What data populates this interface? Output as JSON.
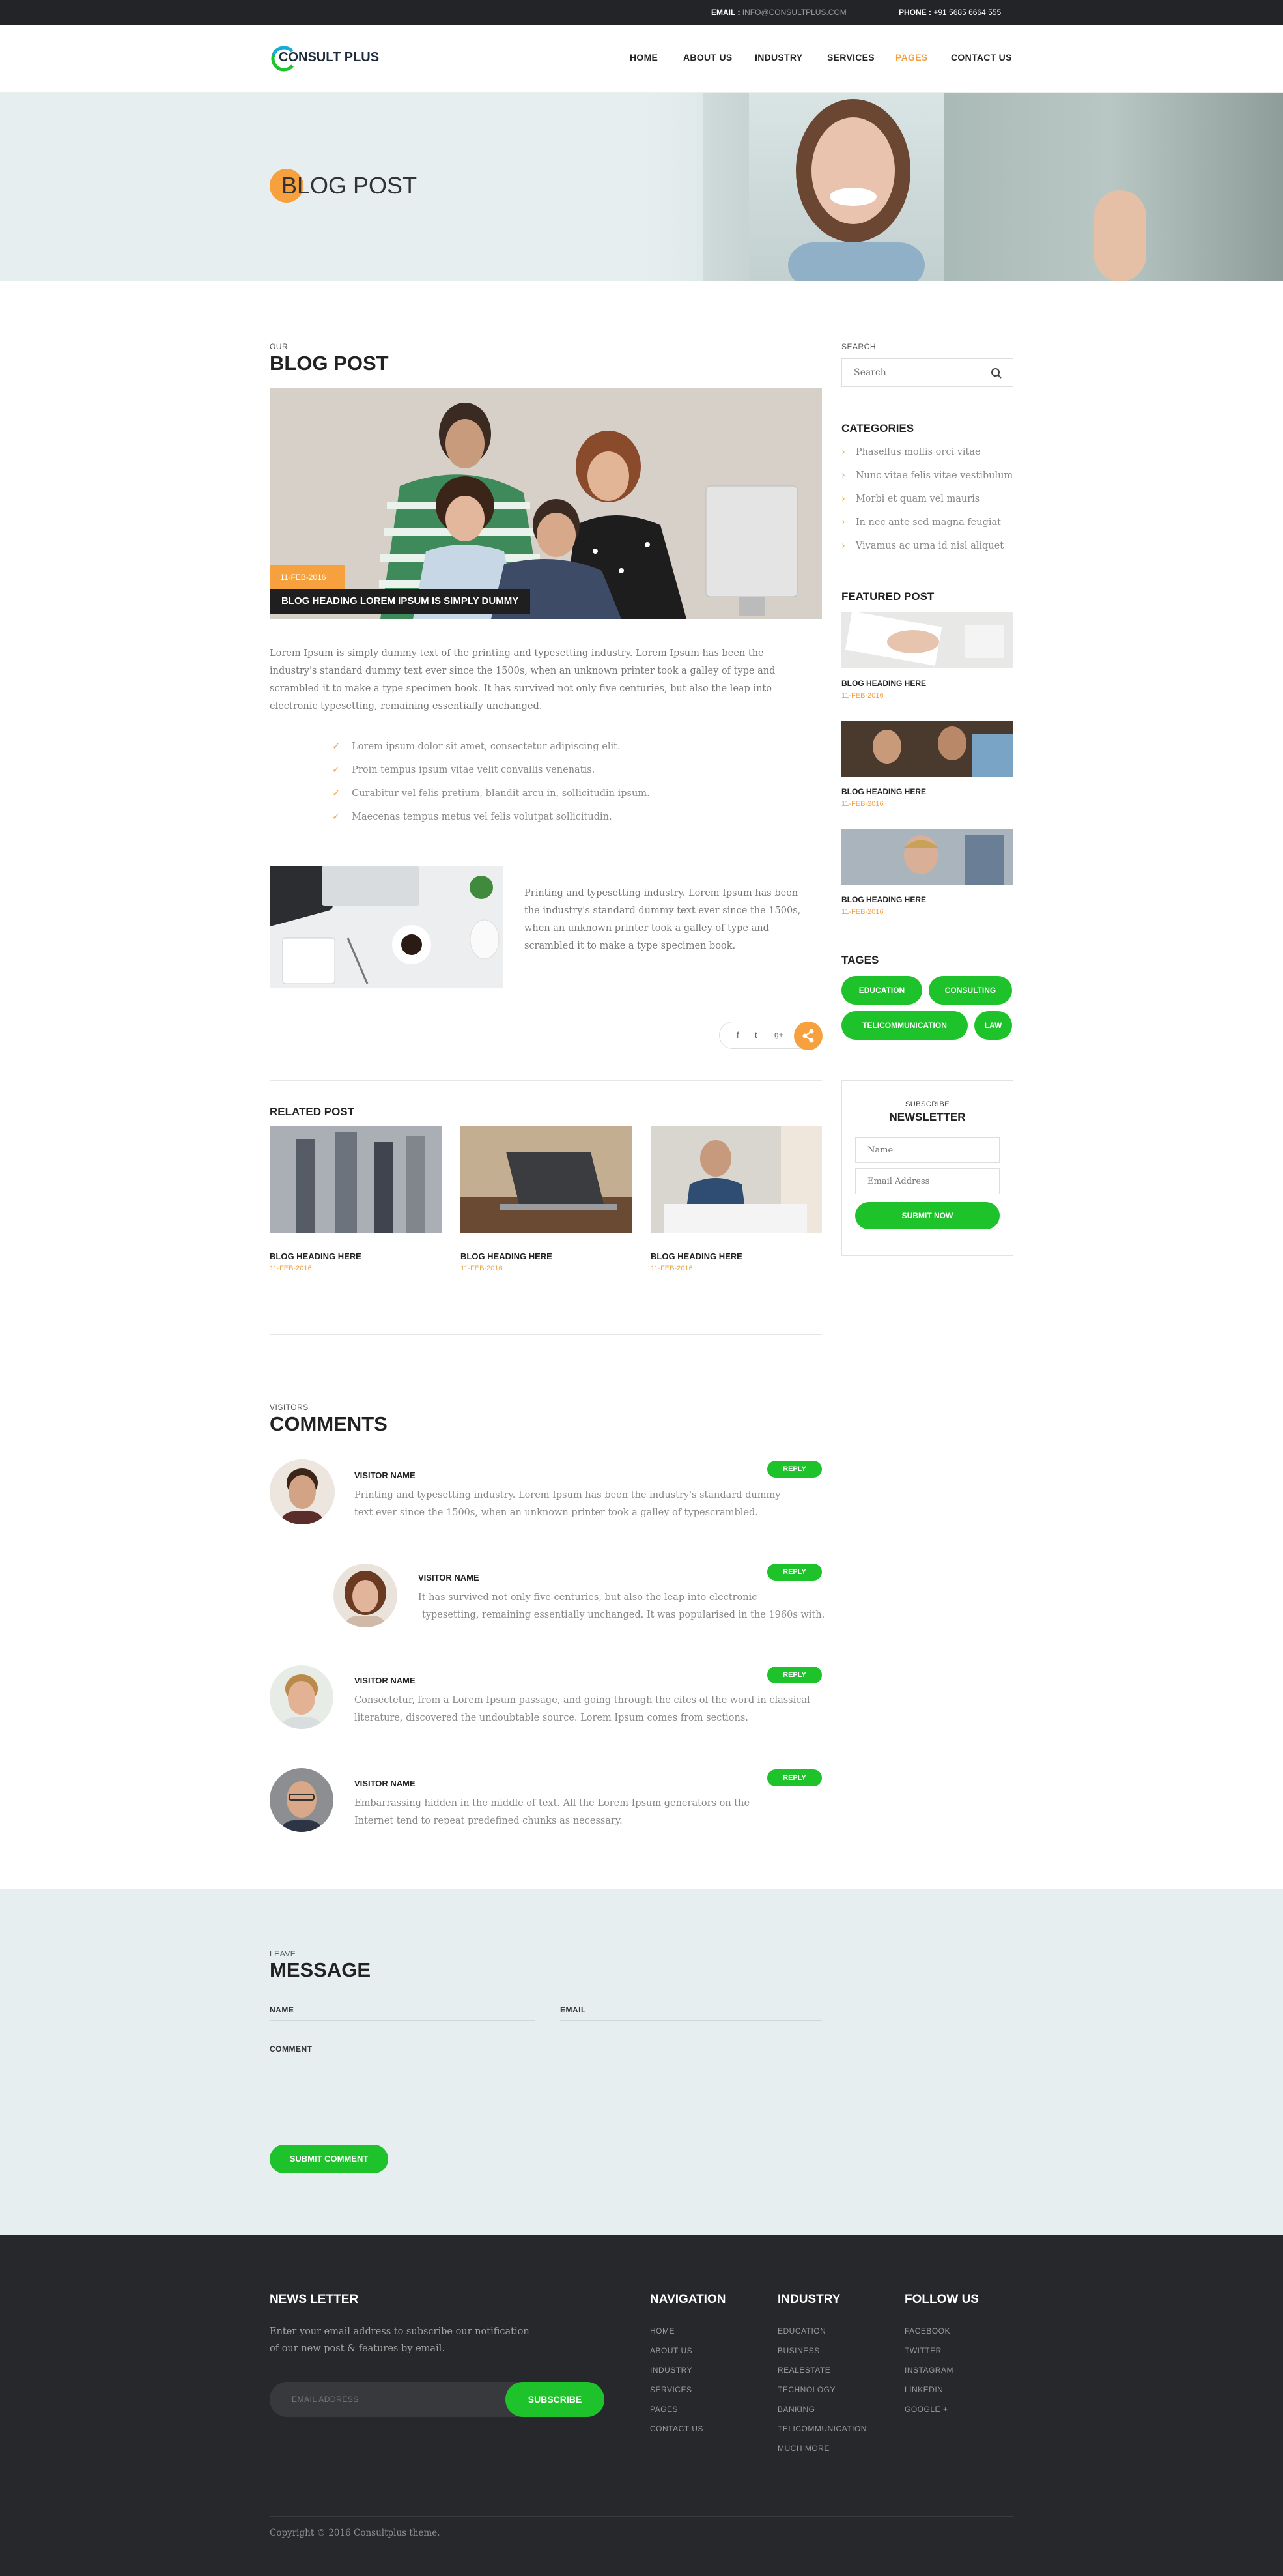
{
  "topbar": {
    "email_label": "EMAIL :",
    "email_value": "INFO@CONSULTPLUS.COM",
    "phone_label": "PHONE :",
    "phone_value": "+91 5685 6664 555"
  },
  "brand": {
    "logo_letter": "C",
    "logo_rest": "ONSULT PLUS"
  },
  "nav": {
    "items": [
      "HOME",
      "ABOUT US",
      "INDUSTRY",
      "SERVICES",
      "PAGES",
      "CONTACT US"
    ],
    "active": "PAGES"
  },
  "hero": {
    "title_first": "B",
    "title_rest": "LOG POST"
  },
  "main": {
    "eyebrow": "OUR",
    "title": "BLOG POST",
    "image_date": "11-FEB-2016",
    "image_heading": "BLOG HEADING LOREM IPSUM IS SIMPLY DUMMY",
    "paragraph": "Lorem Ipsum is simply dummy text of the printing and typesetting industry. Lorem Ipsum has been the industry's standard dummy text ever since the 1500s, when an unknown printer took a galley of type and scrambled it to make a type specimen book. It has survived not only five centuries, but also the leap into electronic typesetting, remaining essentially unchanged.",
    "checklist": [
      "Lorem ipsum dolor sit amet, consectetur adipiscing elit.",
      "Proin tempus ipsum vitae velit convallis venenatis.",
      "Curabitur vel felis pretium, blandit arcu in, sollicitudin ipsum.",
      "Maecenas tempus metus vel felis volutpat sollicitudin."
    ],
    "side_text": "Printing and typesetting industry. Lorem Ipsum has been the industry's standard dummy text ever since the 1500s, when an unknown printer took a galley of type and scrambled it to make a type specimen book.",
    "share": {
      "facebook": "f",
      "twitter": "t",
      "google": "g+"
    }
  },
  "related": {
    "title": "RELATED POST",
    "posts": [
      {
        "heading": "BLOG HEADING HERE",
        "date": "11-FEB-2016"
      },
      {
        "heading": "BLOG HEADING HERE",
        "date": "11-FEB-2016"
      },
      {
        "heading": "BLOG HEADING HERE",
        "date": "11-FEB-2016"
      }
    ]
  },
  "sidebar": {
    "search_label": "SEARCH",
    "search_placeholder": "Search",
    "categories_title": "CATEGORIES",
    "categories": [
      "Phasellus mollis orci vitae",
      "Nunc vitae felis vitae vestibulum",
      "Morbi et quam vel mauris",
      "In nec ante sed magna feugiat",
      "Vivamus ac urna id nisl aliquet"
    ],
    "featured_title": "FEATURED POST",
    "featured": [
      {
        "heading": "BLOG HEADING HERE",
        "date": "11-FEB-2016"
      },
      {
        "heading": "BLOG HEADING HERE",
        "date": "11-FEB-2016"
      },
      {
        "heading": "BLOG HEADING HERE",
        "date": "11-FEB-2016"
      }
    ],
    "tags_title": "TAGES",
    "tags": [
      "EDUCATION",
      "CONSULTING",
      "TELICOMMUNICATION",
      "LAW"
    ],
    "newsletter": {
      "eyebrow": "SUBSCRIBE",
      "title": "NEWSLETTER",
      "name_placeholder": "Name",
      "email_placeholder": "Email Address",
      "button": "SUBMIT NOW"
    }
  },
  "comments": {
    "eyebrow": "VISITORS",
    "title": "COMMENTS",
    "reply_label": "REPLY",
    "items": [
      {
        "name": "VISITOR NAME",
        "text1": "Printing and typesetting industry. Lorem Ipsum has been the industry's standard dummy",
        "text2": "text ever since the 1500s, when an unknown printer took a galley of typescrambled."
      },
      {
        "name": "VISITOR NAME",
        "text1": "It has survived not only five centuries, but also the leap into electronic",
        "text2": "typesetting, remaining essentially unchanged. It was popularised in the 1960s with."
      },
      {
        "name": "VISITOR NAME",
        "text1": "Consectetur, from a Lorem Ipsum passage, and going through the cites of the word in classical",
        "text2": "literature, discovered the undoubtable source. Lorem Ipsum comes from sections."
      },
      {
        "name": "VISITOR NAME",
        "text1": "Embarrassing hidden in the middle of text. All the Lorem Ipsum generators on the",
        "text2": "Internet tend to repeat predefined chunks as necessary."
      }
    ]
  },
  "message": {
    "eyebrow": "LEAVE",
    "title": "MESSAGE",
    "name_label": "NAME",
    "email_label": "EMAIL",
    "comment_label": "COMMENT",
    "button": "SUBMIT COMMENT"
  },
  "footer": {
    "newsletter_title": "NEWS LETTER",
    "newsletter_text1": "Enter your email address to subscribe our notification",
    "newsletter_text2": "of our new post & features by email.",
    "email_placeholder": "EMAIL ADDRESS",
    "subscribe": "SUBSCRIBE",
    "navigation_title": "NAVIGATION",
    "navigation": [
      "HOME",
      "ABOUT US",
      "INDUSTRY",
      "SERVICES",
      "PAGES",
      "CONTACT US"
    ],
    "industry_title": "INDUSTRY",
    "industry": [
      "EDUCATION",
      "BUSINESS",
      "REALESTATE",
      "TECHNOLOGY",
      "BANKING",
      "TELICOMMUNICATION",
      "MUCH MORE"
    ],
    "follow_title": "FOLLOW US",
    "follow": [
      "FACEBOOK",
      "TWITTER",
      "INSTAGRAM",
      "LINKEDIN",
      "GOOGLE +"
    ],
    "copyright": "Copyright © 2016 Consultplus theme."
  },
  "colors": {
    "accent": "#f7a13e",
    "green": "#1ec22a",
    "dark": "#232427",
    "light_band": "#e6eeef"
  }
}
